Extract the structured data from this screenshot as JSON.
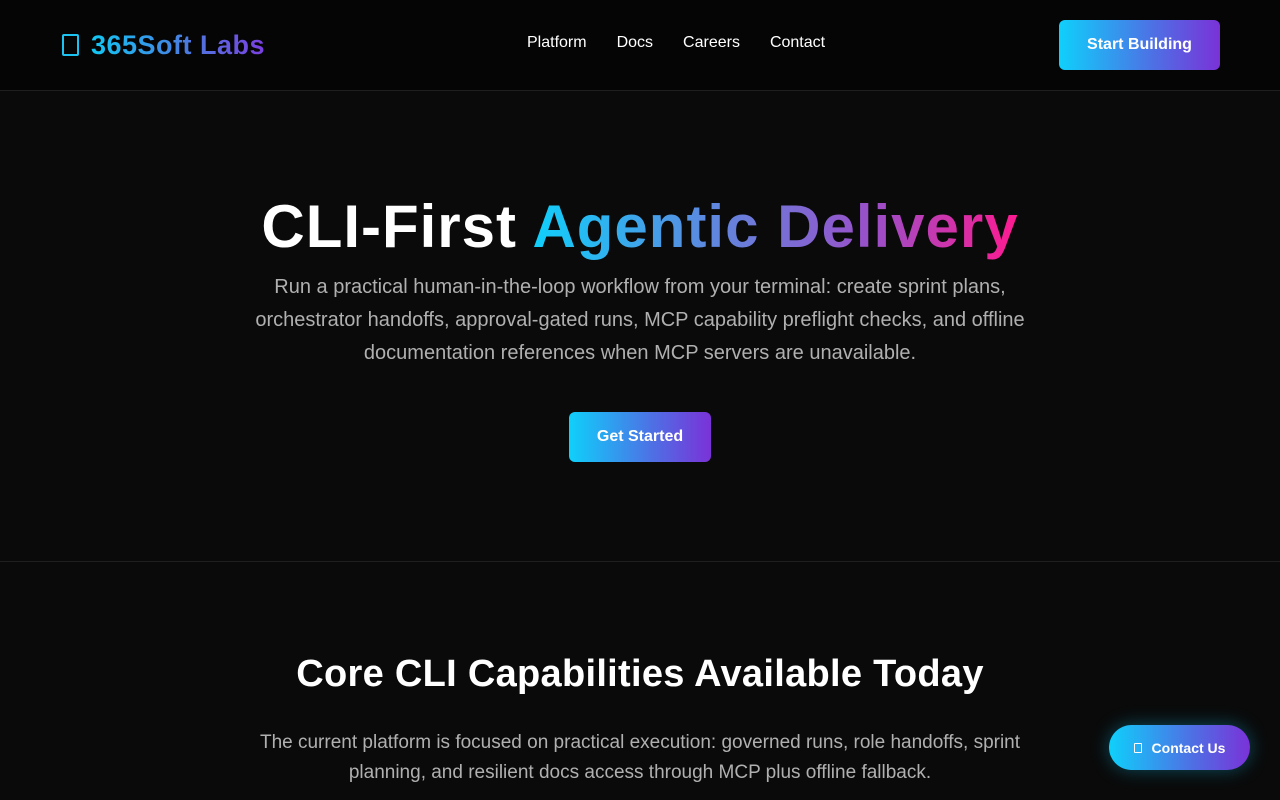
{
  "header": {
    "logo_text": "365Soft Labs",
    "nav": [
      "Platform",
      "Docs",
      "Careers",
      "Contact"
    ],
    "cta_label": "Start Building"
  },
  "hero": {
    "title_plain": "CLI-First ",
    "title_gradient": "Agentic Delivery",
    "description": "Run a practical human-in-the-loop workflow from your terminal: create sprint plans, orchestrator handoffs, approval-gated runs, MCP capability preflight checks, and offline documentation references when MCP servers are unavailable.",
    "cta_label": "Get Started"
  },
  "capabilities": {
    "title": "Core CLI Capabilities Available Today",
    "description": "The current platform is focused on practical execution: governed runs, role handoffs, sprint planning, and resilient docs access through MCP plus offline fallback."
  },
  "floating_contact": {
    "label": "Contact Us",
    "icon": "chat-icon"
  },
  "colors": {
    "background": "#0a0a0a",
    "accent_start": "#0fd0fb",
    "accent_end": "#7a32d8",
    "pink": "#ff1a90"
  }
}
